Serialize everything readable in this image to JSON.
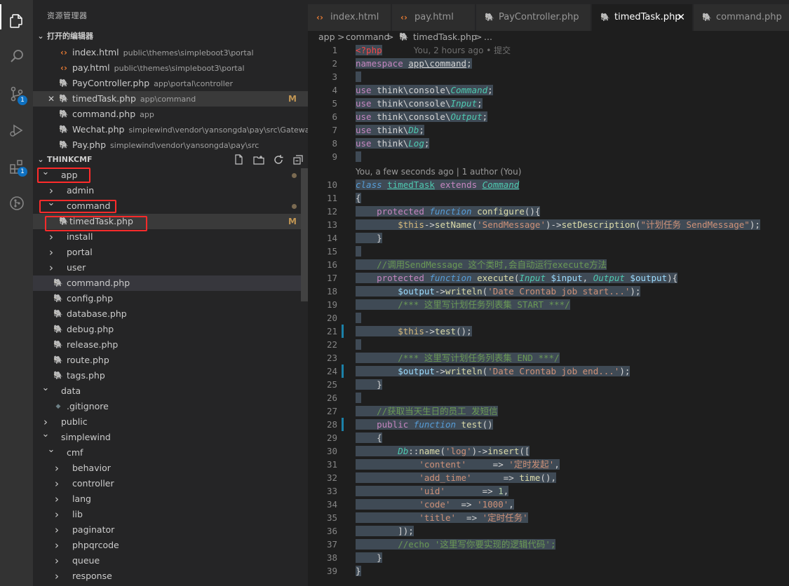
{
  "activity": {
    "items": [
      {
        "name": "explorer-icon"
      },
      {
        "name": "search-icon"
      },
      {
        "name": "source-control-icon",
        "badge": "1"
      },
      {
        "name": "debug-icon"
      },
      {
        "name": "extensions-icon",
        "badge": "1"
      },
      {
        "name": "git-history-icon"
      }
    ]
  },
  "sidebar": {
    "title": "资源管理器",
    "open_editors_header": "打开的编辑器",
    "open_editors": [
      {
        "name": "index.html",
        "path": "public\\themes\\simpleboot3\\portal",
        "icon": "html-icon"
      },
      {
        "name": "pay.html",
        "path": "public\\themes\\simpleboot3\\portal",
        "icon": "html-icon"
      },
      {
        "name": "PayController.php",
        "path": "app\\portal\\controller",
        "icon": "php-icon"
      },
      {
        "name": "timedTask.php",
        "path": "app\\command",
        "icon": "php-icon",
        "mark": "M",
        "close": "✕"
      },
      {
        "name": "command.php",
        "path": "app",
        "icon": "php-icon"
      },
      {
        "name": "Wechat.php",
        "path": "simplewind\\vendor\\yansongda\\pay\\src\\Gateways",
        "icon": "php-icon"
      },
      {
        "name": "Pay.php",
        "path": "simplewind\\vendor\\yansongda\\pay\\src",
        "icon": "php-icon"
      }
    ],
    "project_header": "THINKCMF",
    "tree": [
      {
        "label": "app",
        "depth": 1,
        "type": "folder-open"
      },
      {
        "label": "admin",
        "depth": 2,
        "type": "folder"
      },
      {
        "label": "command",
        "depth": 2,
        "type": "folder-open"
      },
      {
        "label": "timedTask.php",
        "depth": 3,
        "type": "php",
        "mark": "M"
      },
      {
        "label": "install",
        "depth": 2,
        "type": "folder"
      },
      {
        "label": "portal",
        "depth": 2,
        "type": "folder"
      },
      {
        "label": "user",
        "depth": 2,
        "type": "folder"
      },
      {
        "label": "command.php",
        "depth": 2,
        "type": "php"
      },
      {
        "label": "config.php",
        "depth": 2,
        "type": "php"
      },
      {
        "label": "database.php",
        "depth": 2,
        "type": "php"
      },
      {
        "label": "debug.php",
        "depth": 2,
        "type": "php"
      },
      {
        "label": "release.php",
        "depth": 2,
        "type": "php"
      },
      {
        "label": "route.php",
        "depth": 2,
        "type": "php"
      },
      {
        "label": "tags.php",
        "depth": 2,
        "type": "php"
      },
      {
        "label": "data",
        "depth": 1,
        "type": "folder-open"
      },
      {
        "label": ".gitignore",
        "depth": 2,
        "type": "file"
      },
      {
        "label": "public",
        "depth": 1,
        "type": "folder"
      },
      {
        "label": "simplewind",
        "depth": 1,
        "type": "folder-open"
      },
      {
        "label": "cmf",
        "depth": 2,
        "type": "folder-open"
      },
      {
        "label": "behavior",
        "depth": 3,
        "type": "folder"
      },
      {
        "label": "controller",
        "depth": 3,
        "type": "folder"
      },
      {
        "label": "lang",
        "depth": 3,
        "type": "folder"
      },
      {
        "label": "lib",
        "depth": 3,
        "type": "folder"
      },
      {
        "label": "paginator",
        "depth": 3,
        "type": "folder"
      },
      {
        "label": "phpqrcode",
        "depth": 3,
        "type": "folder"
      },
      {
        "label": "queue",
        "depth": 3,
        "type": "folder"
      },
      {
        "label": "response",
        "depth": 3,
        "type": "folder"
      }
    ]
  },
  "tabs": [
    {
      "label": "index.html",
      "icon": "html-icon"
    },
    {
      "label": "pay.html",
      "icon": "html-icon"
    },
    {
      "label": "PayController.php",
      "icon": "php-icon"
    },
    {
      "label": "timedTask.php",
      "icon": "php-icon",
      "active": true,
      "close": "✕"
    },
    {
      "label": "command.php",
      "icon": "php-icon"
    }
  ],
  "breadcrumb": [
    "app",
    ">",
    "command",
    ">",
    "timedTask.php",
    ">",
    "..."
  ],
  "editor": {
    "blame_line1": "You, 2 hours ago • 提交",
    "codelens": "You, a few seconds ago | 1 author (You)",
    "line_numbers": [
      "1",
      "2",
      "3",
      "4",
      "5",
      "6",
      "7",
      "8",
      "9",
      "10",
      "11",
      "12",
      "13",
      "14",
      "15",
      "16",
      "17",
      "18",
      "19",
      "20",
      "21",
      "22",
      "23",
      "24",
      "25",
      "26",
      "27",
      "28",
      "29",
      "30",
      "31",
      "32",
      "33",
      "34",
      "35",
      "36",
      "37",
      "38",
      "39"
    ]
  },
  "colors": {
    "activity_bg": "#333333",
    "sidebar_bg": "#252526",
    "editor_bg": "#1e1e1e",
    "selection": "#3f4a55",
    "annotation_box": "#ff2b2b",
    "badge": "#0e70c0"
  }
}
